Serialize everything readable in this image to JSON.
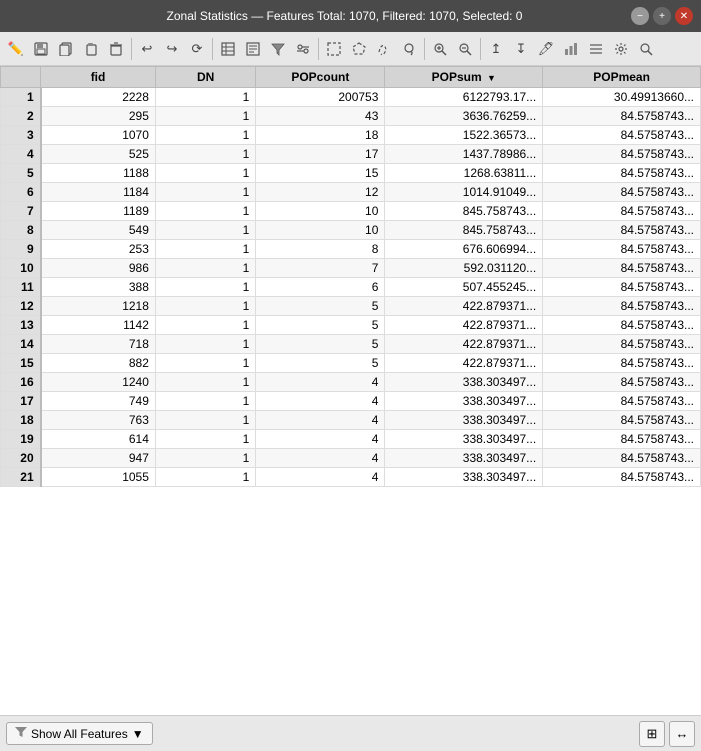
{
  "titleBar": {
    "title": "Zonal Statistics — Features Total: 1070, Filtered: 1070, Selected: 0",
    "minimize": "−",
    "maximize": "+",
    "close": "✕"
  },
  "toolbar": {
    "buttons": [
      {
        "name": "pencil-icon",
        "icon": "✏"
      },
      {
        "name": "save-icon",
        "icon": "💾"
      },
      {
        "name": "copy-icon",
        "icon": "📋"
      },
      {
        "name": "paste-icon",
        "icon": "📌"
      },
      {
        "name": "delete-icon",
        "icon": "🗑"
      },
      {
        "sep": true
      },
      {
        "name": "undo-icon",
        "icon": "↩"
      },
      {
        "name": "redo-icon",
        "icon": "↪"
      },
      {
        "name": "refresh-icon",
        "icon": "⟳"
      },
      {
        "sep": true
      },
      {
        "name": "table-icon",
        "icon": "▦"
      },
      {
        "name": "grid-icon",
        "icon": "⊞"
      },
      {
        "name": "filter-icon",
        "icon": "▼"
      },
      {
        "name": "filter2-icon",
        "icon": "⧖"
      },
      {
        "sep": true
      },
      {
        "name": "select-rect-icon",
        "icon": "⬜"
      },
      {
        "name": "select-poly-icon",
        "icon": "⬡"
      },
      {
        "name": "select-freehand-icon",
        "icon": "✦"
      },
      {
        "name": "lasso-icon",
        "icon": "◎"
      },
      {
        "sep": true
      },
      {
        "name": "zoom-in-icon",
        "icon": "⊕"
      },
      {
        "name": "zoom-out-icon",
        "icon": "⊖"
      },
      {
        "name": "zoom-fit-icon",
        "icon": "⊡"
      },
      {
        "sep": true
      },
      {
        "name": "export-icon",
        "icon": "↥"
      },
      {
        "name": "import-icon",
        "icon": "↧"
      },
      {
        "name": "edit-icon",
        "icon": "🖊"
      },
      {
        "name": "chart-icon",
        "icon": "📊"
      },
      {
        "name": "stats-icon",
        "icon": "≡"
      },
      {
        "name": "config-icon",
        "icon": "⚙"
      },
      {
        "name": "search-icon",
        "icon": "🔍"
      }
    ]
  },
  "table": {
    "columns": [
      {
        "key": "rownum",
        "label": ""
      },
      {
        "key": "fid",
        "label": "fid"
      },
      {
        "key": "dn",
        "label": "DN"
      },
      {
        "key": "popcount",
        "label": "POPcount"
      },
      {
        "key": "popsum",
        "label": "POPsum",
        "sorted": "desc"
      },
      {
        "key": "popmean",
        "label": "POPmean"
      }
    ],
    "rows": [
      {
        "rownum": "1",
        "fid": "2228",
        "dn": "1",
        "popcount": "200753",
        "popsum": "6122793.17...",
        "popmean": "30.49913660..."
      },
      {
        "rownum": "2",
        "fid": "295",
        "dn": "1",
        "popcount": "43",
        "popsum": "3636.76259...",
        "popmean": "84.5758743..."
      },
      {
        "rownum": "3",
        "fid": "1070",
        "dn": "1",
        "popcount": "18",
        "popsum": "1522.36573...",
        "popmean": "84.5758743..."
      },
      {
        "rownum": "4",
        "fid": "525",
        "dn": "1",
        "popcount": "17",
        "popsum": "1437.78986...",
        "popmean": "84.5758743..."
      },
      {
        "rownum": "5",
        "fid": "1188",
        "dn": "1",
        "popcount": "15",
        "popsum": "1268.63811...",
        "popmean": "84.5758743..."
      },
      {
        "rownum": "6",
        "fid": "1184",
        "dn": "1",
        "popcount": "12",
        "popsum": "1014.91049...",
        "popmean": "84.5758743..."
      },
      {
        "rownum": "7",
        "fid": "1189",
        "dn": "1",
        "popcount": "10",
        "popsum": "845.758743...",
        "popmean": "84.5758743..."
      },
      {
        "rownum": "8",
        "fid": "549",
        "dn": "1",
        "popcount": "10",
        "popsum": "845.758743...",
        "popmean": "84.5758743..."
      },
      {
        "rownum": "9",
        "fid": "253",
        "dn": "1",
        "popcount": "8",
        "popsum": "676.606994...",
        "popmean": "84.5758743..."
      },
      {
        "rownum": "10",
        "fid": "986",
        "dn": "1",
        "popcount": "7",
        "popsum": "592.031120...",
        "popmean": "84.5758743..."
      },
      {
        "rownum": "11",
        "fid": "388",
        "dn": "1",
        "popcount": "6",
        "popsum": "507.455245...",
        "popmean": "84.5758743..."
      },
      {
        "rownum": "12",
        "fid": "1218",
        "dn": "1",
        "popcount": "5",
        "popsum": "422.879371...",
        "popmean": "84.5758743..."
      },
      {
        "rownum": "13",
        "fid": "1142",
        "dn": "1",
        "popcount": "5",
        "popsum": "422.879371...",
        "popmean": "84.5758743..."
      },
      {
        "rownum": "14",
        "fid": "718",
        "dn": "1",
        "popcount": "5",
        "popsum": "422.879371...",
        "popmean": "84.5758743..."
      },
      {
        "rownum": "15",
        "fid": "882",
        "dn": "1",
        "popcount": "5",
        "popsum": "422.879371...",
        "popmean": "84.5758743..."
      },
      {
        "rownum": "16",
        "fid": "1240",
        "dn": "1",
        "popcount": "4",
        "popsum": "338.303497...",
        "popmean": "84.5758743..."
      },
      {
        "rownum": "17",
        "fid": "749",
        "dn": "1",
        "popcount": "4",
        "popsum": "338.303497...",
        "popmean": "84.5758743..."
      },
      {
        "rownum": "18",
        "fid": "763",
        "dn": "1",
        "popcount": "4",
        "popsum": "338.303497...",
        "popmean": "84.5758743..."
      },
      {
        "rownum": "19",
        "fid": "614",
        "dn": "1",
        "popcount": "4",
        "popsum": "338.303497...",
        "popmean": "84.5758743..."
      },
      {
        "rownum": "20",
        "fid": "947",
        "dn": "1",
        "popcount": "4",
        "popsum": "338.303497...",
        "popmean": "84.5758743..."
      },
      {
        "rownum": "21",
        "fid": "1055",
        "dn": "1",
        "popcount": "4",
        "popsum": "338.303497...",
        "popmean": "84.5758743..."
      }
    ]
  },
  "bottomBar": {
    "showAllLabel": "Show All Features",
    "filterIcon": "▼",
    "icon1": "⊞",
    "icon2": "↔"
  }
}
